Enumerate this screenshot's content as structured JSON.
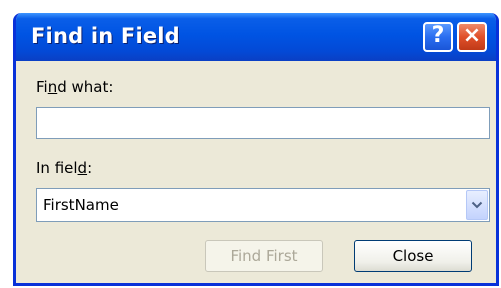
{
  "dialog": {
    "title": "Find in Field",
    "help_button_label": "?",
    "close_button_label": "×"
  },
  "find_what": {
    "label_before": "Fi",
    "label_access": "n",
    "label_after": "d what:",
    "value": ""
  },
  "in_field": {
    "label_before": "In fiel",
    "label_access": "d",
    "label_after": ":",
    "selected": "FirstName"
  },
  "buttons": {
    "find_first": "Find First",
    "close": "Close"
  },
  "icons": {
    "dropdown_arrow": "chevron-down-icon"
  }
}
